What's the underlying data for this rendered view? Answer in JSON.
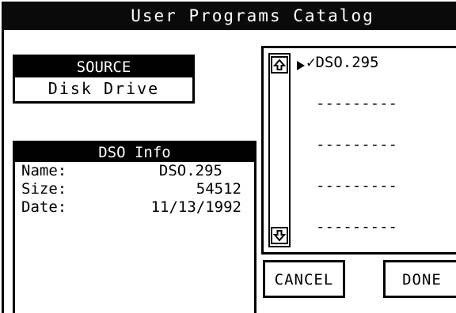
{
  "window": {
    "title": "User Programs Catalog"
  },
  "source": {
    "heading": "SOURCE",
    "value": "Disk Drive"
  },
  "info": {
    "heading": "DSO Info",
    "rows": [
      {
        "label": "Name:",
        "value": "DSO.295"
      },
      {
        "label": "Size:",
        "value": "54512"
      },
      {
        "label": "Date:",
        "value": "11/13/1992"
      }
    ]
  },
  "list": {
    "items": [
      {
        "text": "DSO.295",
        "checked": true,
        "check": "✓"
      },
      {
        "text": "---------",
        "checked": false,
        "check": ""
      },
      {
        "text": "---------",
        "checked": false,
        "check": ""
      },
      {
        "text": "---------",
        "checked": false,
        "check": ""
      },
      {
        "text": "---------",
        "checked": false,
        "check": ""
      }
    ]
  },
  "buttons": {
    "cancel_label": "CANCEL",
    "done_label": "DONE"
  },
  "icons": {
    "scroll_up": "scroll-up-arrow-icon",
    "scroll_down": "scroll-down-arrow-icon",
    "selection": "selection-pointer-icon"
  }
}
